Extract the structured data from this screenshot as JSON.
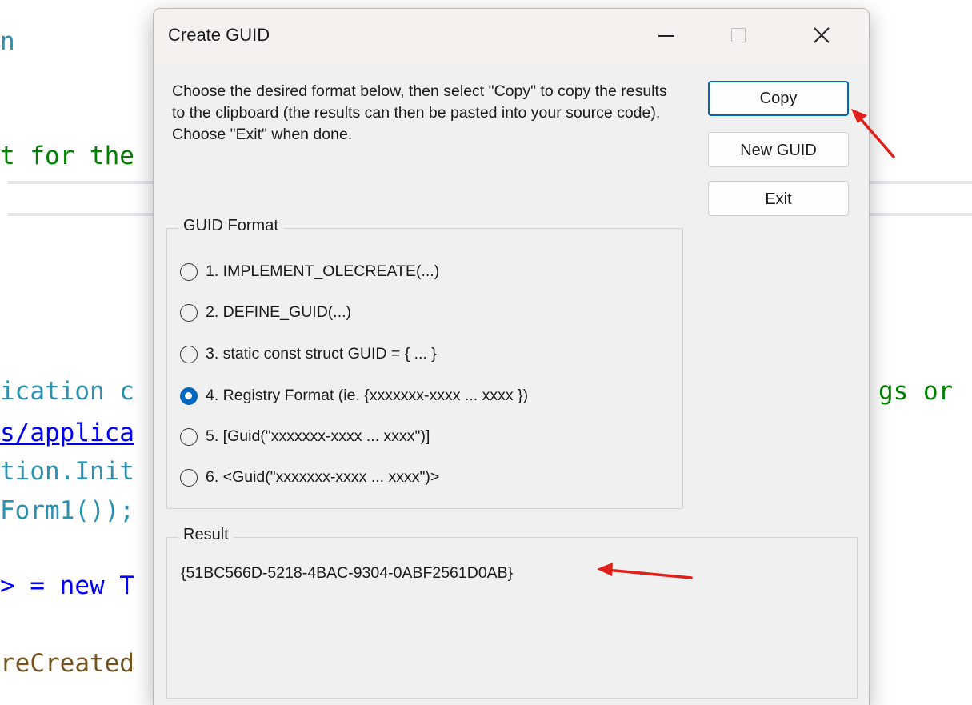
{
  "editor": {
    "lines": [
      {
        "text": "n"
      },
      {
        "text": "t for the"
      },
      {
        "text": "ication c"
      },
      {
        "text": "gs or"
      },
      {
        "text": "s/applica"
      },
      {
        "text": "tion.Init"
      },
      {
        "text": "Form1());"
      },
      {
        "text": "> = new T"
      },
      {
        "text": "reCreated"
      }
    ]
  },
  "dialog": {
    "title": "Create GUID",
    "instructions": "Choose the desired format below, then select \"Copy\" to copy the results to the clipboard (the results can then be pasted into your source code).  Choose \"Exit\" when done.",
    "buttons": {
      "copy": "Copy",
      "new_guid": "New GUID",
      "exit": "Exit"
    },
    "format_group": {
      "label": "GUID Format",
      "options": [
        {
          "label": "1. IMPLEMENT_OLECREATE(...)",
          "selected": false
        },
        {
          "label": "2. DEFINE_GUID(...)",
          "selected": false
        },
        {
          "label": "3. static const struct GUID = { ... }",
          "selected": false
        },
        {
          "label": "4. Registry Format (ie. {xxxxxxx-xxxx ... xxxx })",
          "selected": true
        },
        {
          "label": "5. [Guid(\"xxxxxxx-xxxx ... xxxx\")]",
          "selected": false
        },
        {
          "label": "6. <Guid(\"xxxxxxx-xxxx ... xxxx\")>",
          "selected": false
        }
      ]
    },
    "result_group": {
      "label": "Result",
      "value": "{51BC566D-5218-4BAC-9304-0ABF2561D0AB}"
    }
  },
  "colors": {
    "accent": "#0067c0",
    "annotation_arrow": "#e0201b"
  }
}
